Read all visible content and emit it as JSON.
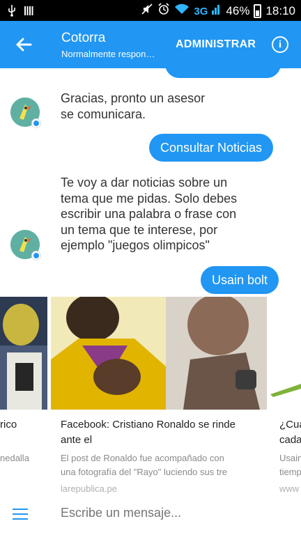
{
  "status_bar": {
    "network": "3G",
    "battery": "46%",
    "time": "18:10"
  },
  "app_bar": {
    "title": "Cotorra",
    "subtitle": "Normalmente responde al instante",
    "admin_label": "ADMINISTRAR",
    "info_icon": "info-icon",
    "back_icon": "back-arrow-icon"
  },
  "messages": {
    "bot_1": [
      "Gracias, pronto un asesor",
      "se comunicara."
    ],
    "user_1": "Consultar Noticias",
    "bot_2": [
      "Te voy a dar noticias sobre un",
      "tema que me pidas. Solo debes",
      "escribir una palabra o frase con",
      "un tema que te interese, por",
      "ejemplo \"juegos olimpicos\""
    ],
    "user_2": "Usain bolt"
  },
  "cards": [
    {
      "title": [
        "rico"
      ],
      "desc": [
        "nedalla"
      ],
      "source": ""
    },
    {
      "title": [
        "Facebook: Cristiano Ronaldo se rinde",
        "ante el"
      ],
      "desc": [
        "El post de Ronaldo fue acompañado con",
        "una fotografía del \"Rayo\" luciendo sus tre"
      ],
      "source": "larepublica.pe"
    },
    {
      "title": [
        "¿Cua",
        "cada"
      ],
      "desc": [
        "Usain",
        "tiemp"
      ],
      "source": "www"
    }
  ],
  "composer": {
    "placeholder": "Escribe un mensaje..."
  },
  "colors": {
    "accent": "#2196f3",
    "status_bar": "#000000"
  }
}
